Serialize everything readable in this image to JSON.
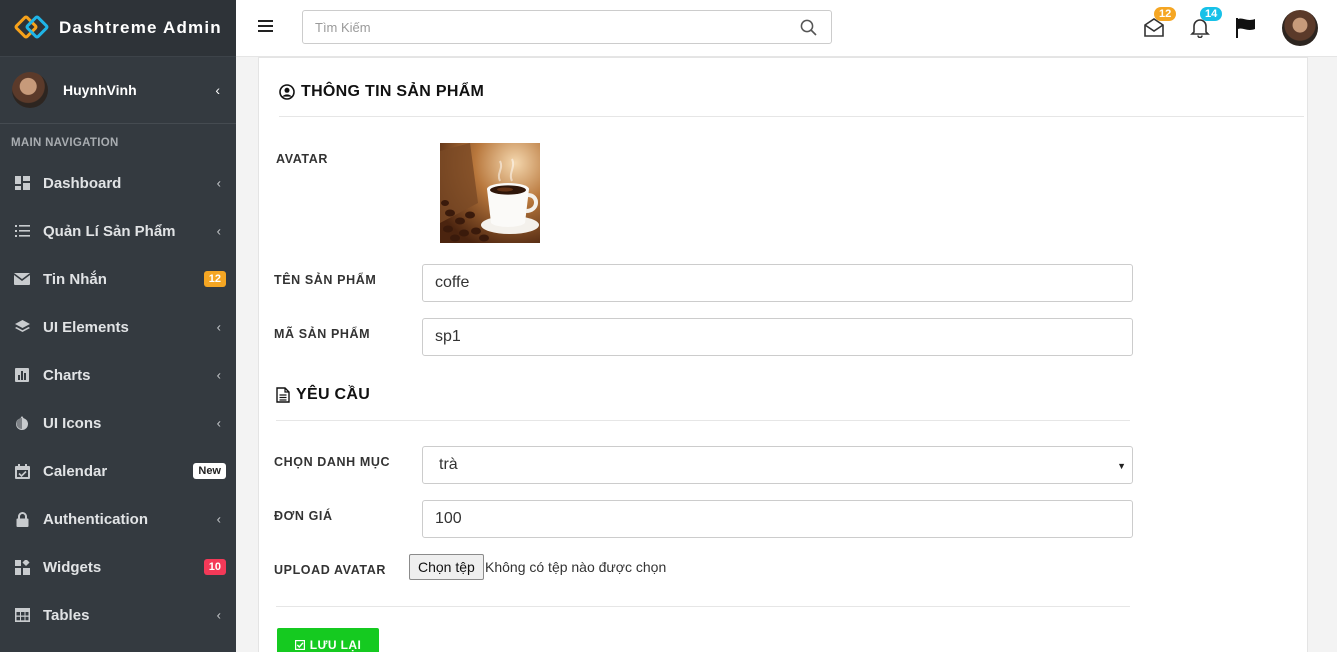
{
  "brand": {
    "name": "Dashtreme Admin"
  },
  "user": {
    "name": "HuynhVinh"
  },
  "sidebar": {
    "header": "MAIN NAVIGATION",
    "items": [
      {
        "label": "Dashboard",
        "icon": "dashboard-icon"
      },
      {
        "label": "Quản Lí Sản Phẩm",
        "icon": "list-icon"
      },
      {
        "label": "Tin Nhắn",
        "icon": "envelope-icon",
        "badge": "12"
      },
      {
        "label": "UI Elements",
        "icon": "layers-icon"
      },
      {
        "label": "Charts",
        "icon": "bar-chart-icon"
      },
      {
        "label": "UI Icons",
        "icon": "droplet-icon"
      },
      {
        "label": "Calendar",
        "icon": "calendar-icon",
        "badge": "New"
      },
      {
        "label": "Authentication",
        "icon": "lock-icon"
      },
      {
        "label": "Widgets",
        "icon": "widgets-icon",
        "badge": "10"
      },
      {
        "label": "Tables",
        "icon": "table-icon"
      }
    ]
  },
  "topbar": {
    "search_placeholder": "Tìm Kiếm",
    "mail_count": "12",
    "notification_count": "14"
  },
  "form": {
    "section1_title": "THÔNG TIN SẢN PHẨM",
    "avatar_label": "AVATAR",
    "name_label": "TÊN SẢN PHẨM",
    "name_value": "coffe",
    "code_label": "MÃ SẢN PHẨM",
    "code_value": "sp1",
    "section2_title": "YÊU CẦU",
    "category_label": "CHỌN DANH MỤC",
    "category_value": "trà",
    "price_label": "ĐƠN GIÁ",
    "price_value": "100",
    "upload_label": "UPLOAD AVATAR",
    "file_button": "Chọn tệp",
    "file_status": "Không có tệp nào được chọn",
    "save_button": "LƯU LẠI"
  },
  "colors": {
    "sidebar_bg": "#343a40",
    "mail_badge": "#f5a623",
    "notification_badge": "#17c1e8",
    "save_button": "#15ca20",
    "widgets_badge": "#f43958"
  }
}
